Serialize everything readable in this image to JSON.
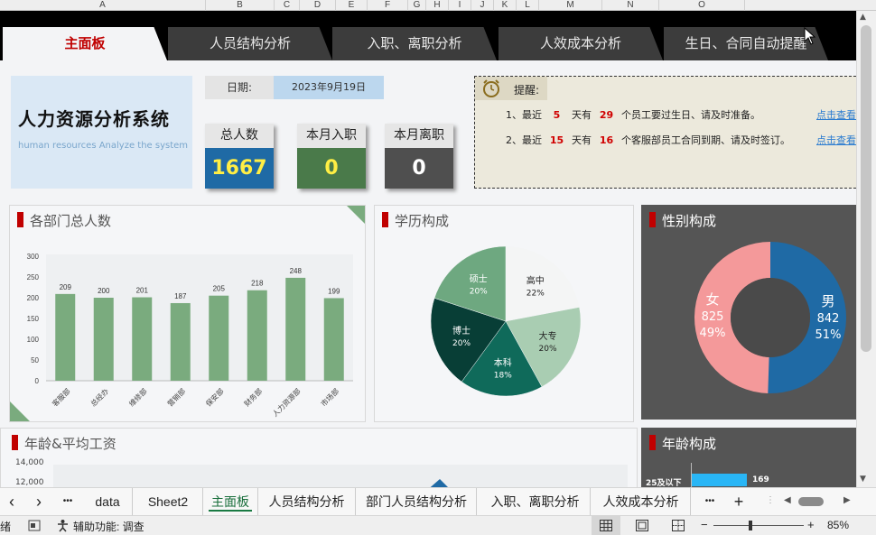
{
  "columns": [
    "A",
    "B",
    "C",
    "D",
    "E",
    "F",
    "G",
    "H",
    "I",
    "J",
    "K",
    "L",
    "M",
    "N",
    "O"
  ],
  "nav_tabs": [
    {
      "label": "主面板",
      "active": true
    },
    {
      "label": "人员结构分析",
      "active": false
    },
    {
      "label": "入职、离职分析",
      "active": false
    },
    {
      "label": "人效成本分析",
      "active": false
    },
    {
      "label": "生日、合同自动提醒",
      "active": false
    }
  ],
  "header": {
    "title_cn": "人力资源分析系统",
    "title_en": "human resources Analyze the system",
    "date_label": "日期:",
    "date_value": "2023年9月19日"
  },
  "kpis": [
    {
      "label": "总人数",
      "value": "1667",
      "bg": "#1f6aa5",
      "color": "#ffee44"
    },
    {
      "label": "本月入职",
      "value": "0",
      "bg": "#4a7a4a",
      "color": "#ffee44"
    },
    {
      "label": "本月离职",
      "value": "0",
      "bg": "#4f4f4f",
      "color": "#ffffff"
    }
  ],
  "reminder": {
    "title": "提醒:",
    "lines": [
      {
        "prefix": "1、最近",
        "n1": "5",
        "mid": "天有",
        "n2": "29",
        "suffix": "个员工要过生日、请及时准备。",
        "link": "点击查看"
      },
      {
        "prefix": "2、最近",
        "n1": "15",
        "mid": "天有",
        "n2": "16",
        "suffix": "个客服部员工合同到期、请及时签订。",
        "link": "点击查看"
      }
    ]
  },
  "panels": {
    "dept": {
      "title": "各部门总人数"
    },
    "edu": {
      "title": "学历构成"
    },
    "gender": {
      "title": "性别构成"
    },
    "age_salary": {
      "title": "年龄&平均工资"
    },
    "age": {
      "title": "年龄构成"
    }
  },
  "chart_data": [
    {
      "type": "bar",
      "title": "各部门总人数",
      "categories": [
        "客服部",
        "总经办",
        "维修部",
        "营销部",
        "保安部",
        "财务部",
        "人力资源部",
        "市场部"
      ],
      "values": [
        209,
        200,
        201,
        187,
        205,
        218,
        248,
        199
      ],
      "ylim": [
        0,
        300
      ],
      "yticks": [
        0,
        50,
        100,
        150,
        200,
        250,
        300
      ],
      "color": "#7aab7e"
    },
    {
      "type": "pie",
      "title": "学历构成",
      "slices": [
        {
          "label": "高中",
          "pct": "22%",
          "value": 22,
          "color": "#f4f5f5"
        },
        {
          "label": "大专",
          "pct": "20%",
          "value": 20,
          "color": "#a9cdb2"
        },
        {
          "label": "本科",
          "pct": "18%",
          "value": 18,
          "color": "#0f6a5a"
        },
        {
          "label": "博士",
          "pct": "20%",
          "value": 20,
          "color": "#083e36"
        },
        {
          "label": "硕士",
          "pct": "20%",
          "value": 20,
          "color": "#6ea880"
        }
      ]
    },
    {
      "type": "pie",
      "title": "性别构成",
      "slices": [
        {
          "label": "男",
          "count": "842",
          "pct": "51%",
          "value": 842,
          "color": "#1f6aa5"
        },
        {
          "label": "女",
          "count": "825",
          "pct": "49%",
          "value": 825,
          "color": "#f4999a"
        }
      ]
    },
    {
      "type": "line",
      "title": "年龄&平均工资",
      "yticks": [
        "14,000",
        "12,000"
      ]
    },
    {
      "type": "bar",
      "title": "年龄构成",
      "categories": [
        "25及以下"
      ],
      "values": [
        169
      ]
    }
  ],
  "sheet_tabs": [
    {
      "label": "data",
      "active": false
    },
    {
      "label": "Sheet2",
      "active": false
    },
    {
      "label": "主面板",
      "active": true
    },
    {
      "label": "人员结构分析",
      "active": false
    },
    {
      "label": "部门人员结构分析",
      "active": false
    },
    {
      "label": "入职、离职分析",
      "active": false
    },
    {
      "label": "人效成本分析",
      "active": false
    }
  ],
  "tab_controls": {
    "prev": "‹",
    "next": "›",
    "more": "•••",
    "add": "+"
  },
  "status": {
    "ready": "绪",
    "accessibility": "辅助功能: 调查",
    "zoom": "85%",
    "zoom_minus": "−",
    "zoom_plus": "+"
  }
}
